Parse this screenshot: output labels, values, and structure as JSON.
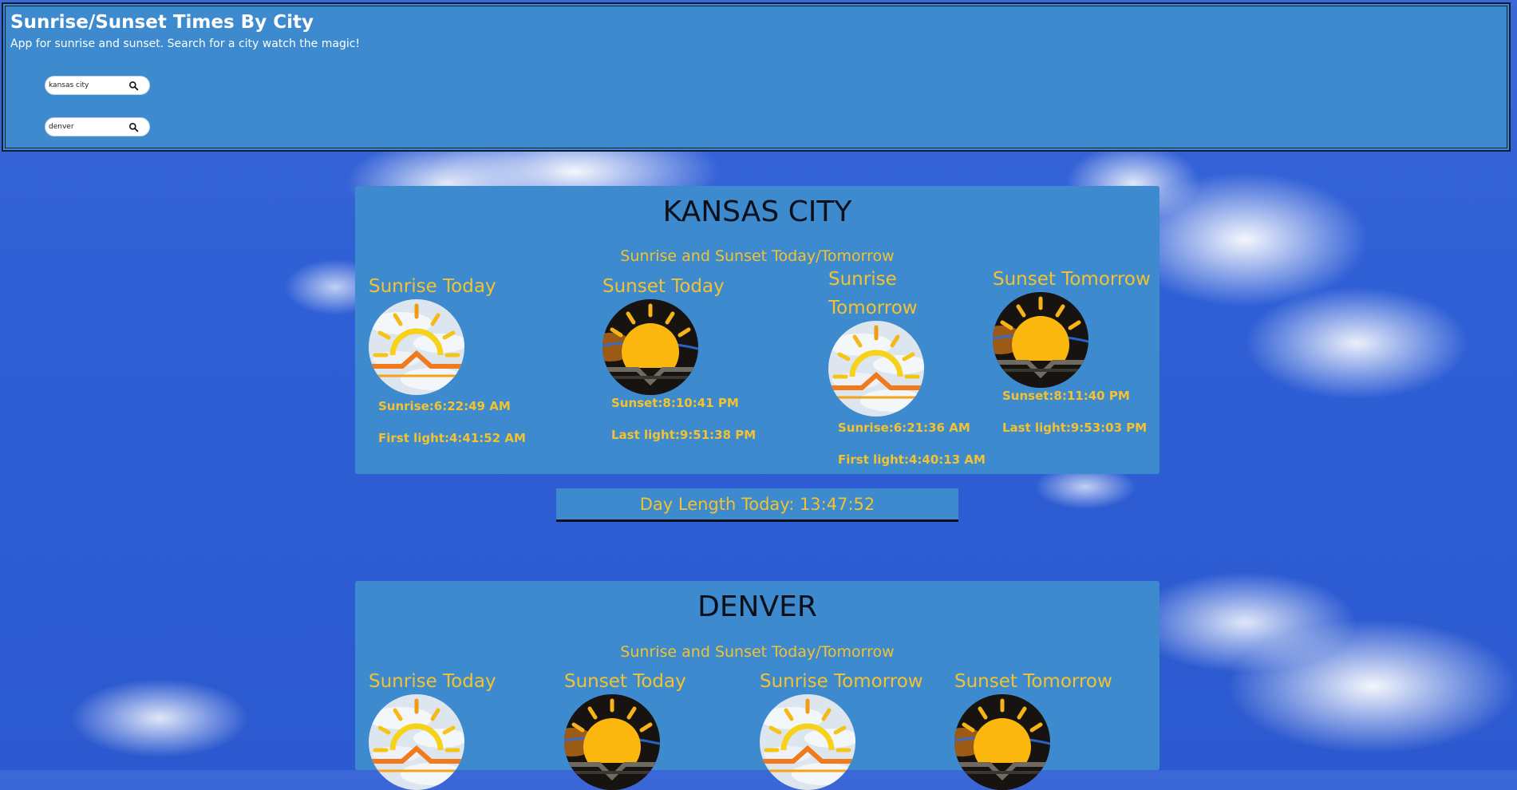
{
  "app": {
    "title": "Sunrise/Sunset Times By City",
    "subtitle": "App for sunrise and sunset. Search for a city watch the magic!"
  },
  "searches": [
    {
      "value": "kansas city",
      "icon": "search-icon"
    },
    {
      "value": "denver",
      "icon": "search-icon"
    }
  ],
  "colors": {
    "panel": "#3d8bce",
    "accent": "#f2c230",
    "title": "#0b0f1a"
  },
  "kansas_city": {
    "name": "KANSAS CITY",
    "subtitle": "Sunrise and Sunset Today/Tomorrow",
    "sunrise_today": {
      "title": "Sunrise Today",
      "line1": "Sunrise:6:22:49 AM",
      "line2": "First light:4:41:52 AM"
    },
    "sunset_today": {
      "title": "Sunset Today",
      "line1": "Sunset:8:10:41 PM",
      "line2": "Last light:9:51:38 PM"
    },
    "sunrise_tomorrow": {
      "title_1": "Sunrise",
      "title_2": "Tomorrow",
      "line1": "Sunrise:6:21:36 AM",
      "line2": "First light:4:40:13 AM"
    },
    "sunset_tomorrow": {
      "title": "Sunset Tomorrow",
      "line1": "Sunset:8:11:40 PM",
      "line2": "Last light:9:53:03 PM"
    },
    "day_length": "Day Length Today: 13:47:52"
  },
  "denver": {
    "name": "DENVER",
    "subtitle": "Sunrise and Sunset Today/Tomorrow",
    "sunrise_today": {
      "title": "Sunrise Today"
    },
    "sunset_today": {
      "title": "Sunset Today"
    },
    "sunrise_tomorrow": {
      "title": "Sunrise Tomorrow"
    },
    "sunset_tomorrow": {
      "title": "Sunset Tomorrow"
    }
  }
}
